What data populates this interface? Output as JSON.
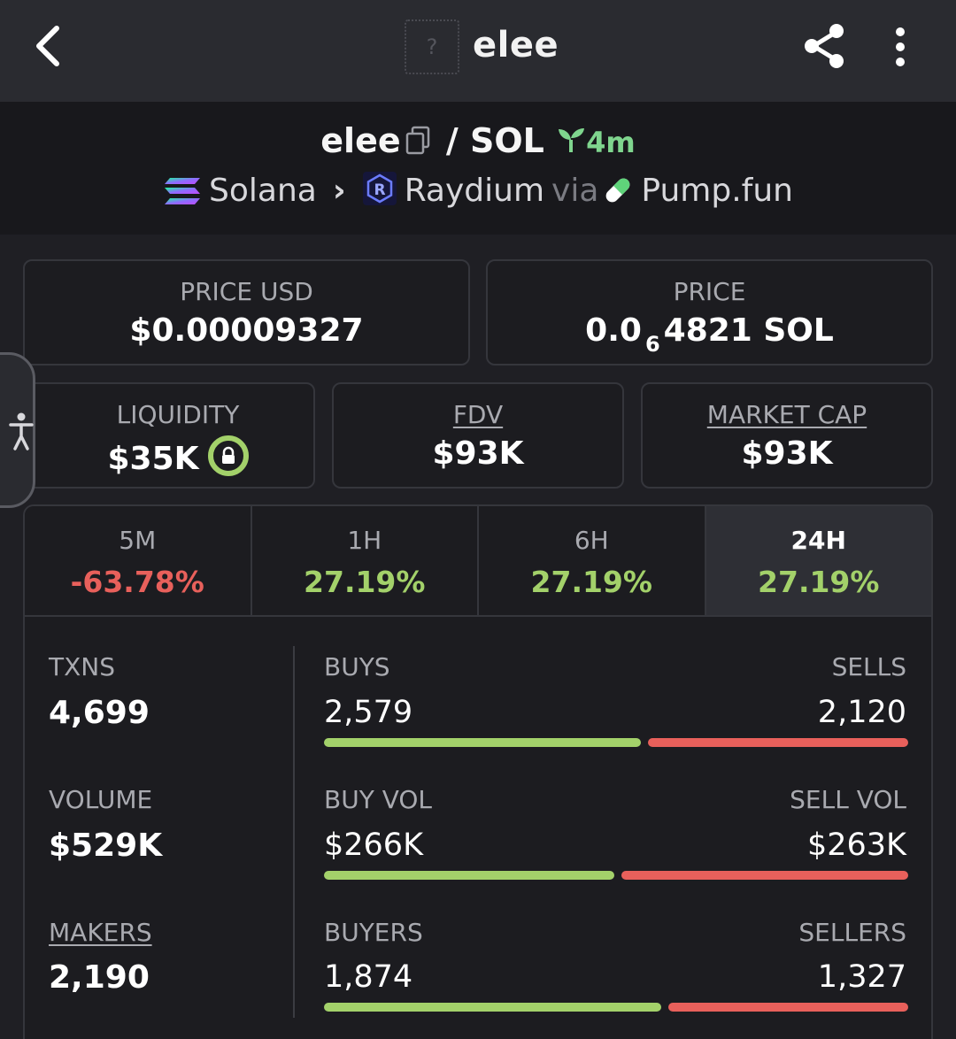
{
  "header": {
    "title": "elee",
    "thumb_placeholder": "?"
  },
  "pair": {
    "base": "elee",
    "quote": "/ SOL",
    "age": "4m",
    "chain": "Solana",
    "dex": "Raydium",
    "via_label": "via",
    "launchpad": "Pump.fun"
  },
  "price_usd": {
    "label": "PRICE USD",
    "value": "$0.00009327"
  },
  "price_sol": {
    "label": "PRICE",
    "prefix": "0.0",
    "zeros": "6",
    "suffix": "4821 SOL"
  },
  "liquidity": {
    "label": "LIQUIDITY",
    "value": "$35K"
  },
  "fdv": {
    "label": "FDV",
    "value": "$93K"
  },
  "market_cap": {
    "label": "MARKET CAP",
    "value": "$93K"
  },
  "tabs": [
    {
      "label": "5M",
      "value": "-63.78%",
      "trend": "down"
    },
    {
      "label": "1H",
      "value": "27.19%",
      "trend": "up"
    },
    {
      "label": "6H",
      "value": "27.19%",
      "trend": "up"
    },
    {
      "label": "24H",
      "value": "27.19%",
      "trend": "up",
      "active": true
    }
  ],
  "stats": {
    "txns": {
      "label": "TXNS",
      "value": "4,699"
    },
    "volume": {
      "label": "VOLUME",
      "value": "$529K"
    },
    "makers": {
      "label": "MAKERS",
      "value": "2,190"
    },
    "buys": {
      "label": "BUYS",
      "value": "2,579",
      "fraction": 0.549
    },
    "sells": {
      "label": "SELLS",
      "value": "2,120"
    },
    "buy_vol": {
      "label": "BUY VOL",
      "value": "$266K",
      "fraction": 0.503
    },
    "sell_vol": {
      "label": "SELL VOL",
      "value": "$263K"
    },
    "buyers": {
      "label": "BUYERS",
      "value": "1,874",
      "fraction": 0.585
    },
    "sellers": {
      "label": "SELLERS",
      "value": "1,327"
    }
  },
  "colors": {
    "positive": "#a3d16a",
    "negative": "#e8605b",
    "age": "#7fd58e"
  }
}
